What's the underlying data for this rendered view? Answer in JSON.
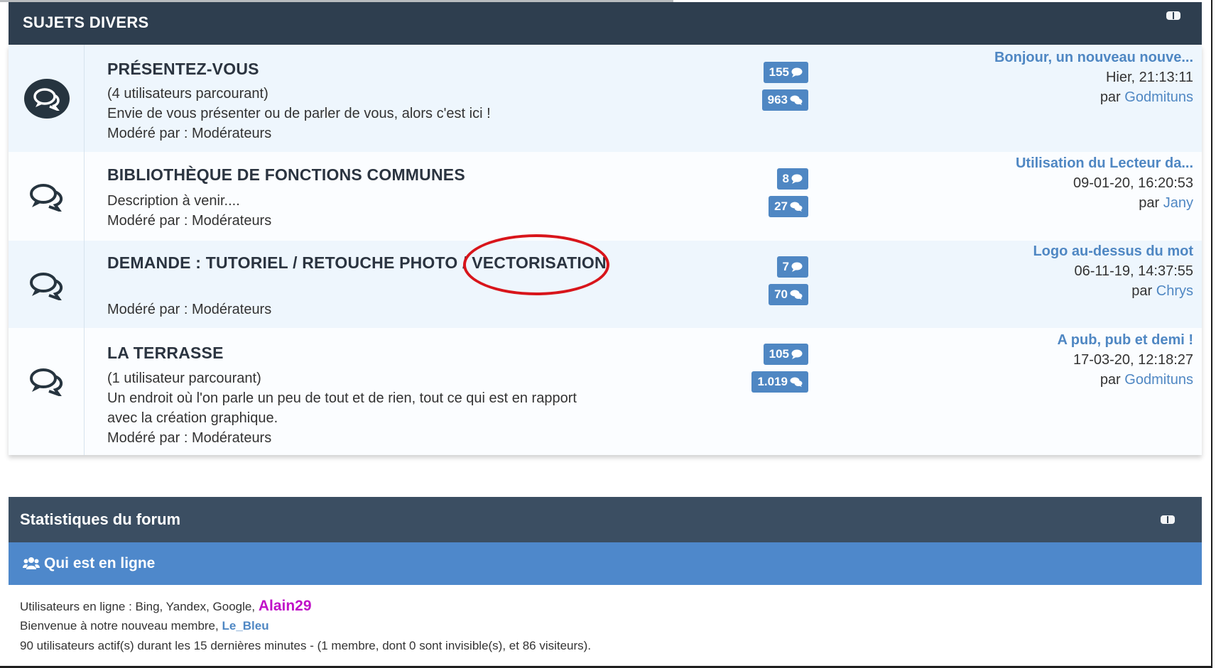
{
  "category": {
    "title": "SUJETS DIVERS"
  },
  "forums": [
    {
      "title": "PRÉSENTEZ-VOUS",
      "browsing": "(4 utilisateurs parcourant)",
      "description": "Envie de vous présenter ou de parler de vous, alors c'est ici !",
      "moderated": "Modéré par : Modérateurs",
      "topics": "155",
      "posts": "963",
      "last_title": "Bonjour, un nouveau nouve...",
      "last_date": "Hier, 21:13:11",
      "last_by_prefix": "par",
      "last_by_user": "Godmituns"
    },
    {
      "title": "BIBLIOTHÈQUE DE FONCTIONS COMMUNES",
      "description": "Description à venir....",
      "moderated": "Modéré par : Modérateurs",
      "topics": "8",
      "posts": "27",
      "last_title": "Utilisation du Lecteur da...",
      "last_date": "09-01-20, 16:20:53",
      "last_by_prefix": "par",
      "last_by_user": "Jany"
    },
    {
      "title": "DEMANDE : TUTORIEL / RETOUCHE PHOTO / VECTORISATION",
      "moderated": "Modéré par : Modérateurs",
      "topics": "7",
      "posts": "70",
      "last_title": "Logo au-dessus du mot",
      "last_date": "06-11-19, 14:37:55",
      "last_by_prefix": "par",
      "last_by_user": "Chrys"
    },
    {
      "title": "LA TERRASSE",
      "browsing": "(1 utilisateur parcourant)",
      "description_line1": "Un endroit où l'on parle un peu de tout et de rien, tout ce qui est en rapport",
      "description_line2": "avec la création graphique.",
      "moderated": "Modéré par : Modérateurs",
      "topics": "105",
      "posts": "1.019",
      "last_title": "A pub, pub et demi !",
      "last_date": "17-03-20, 12:18:27",
      "last_by_prefix": "par",
      "last_by_user": "Godmituns"
    }
  ],
  "stats": {
    "title": "Statistiques du forum",
    "online_title": "Qui est en ligne",
    "online_prefix": "Utilisateurs en ligne : Bing, Yandex, Google,",
    "online_user": "Alain29",
    "welcome_prefix": "Bienvenue à notre nouveau membre,",
    "welcome_user": "Le_Bleu",
    "activity": "90 utilisateurs actif(s) durant les 15 dernières minutes - (1 membre, dont 0 sont invisible(s), et 86 visiteurs)."
  },
  "colors": {
    "header": "#2e3e4f",
    "accent": "#4f87c3",
    "online_bar": "#4e88cb",
    "annotation": "#d8151b",
    "admin_user": "#c010c8"
  },
  "icons": [
    "forum-new-posts-icon",
    "forum-read-icon",
    "topics-bubble-icon",
    "posts-bubbles-icon",
    "users-group-icon",
    "collapse-toggle-icon"
  ]
}
